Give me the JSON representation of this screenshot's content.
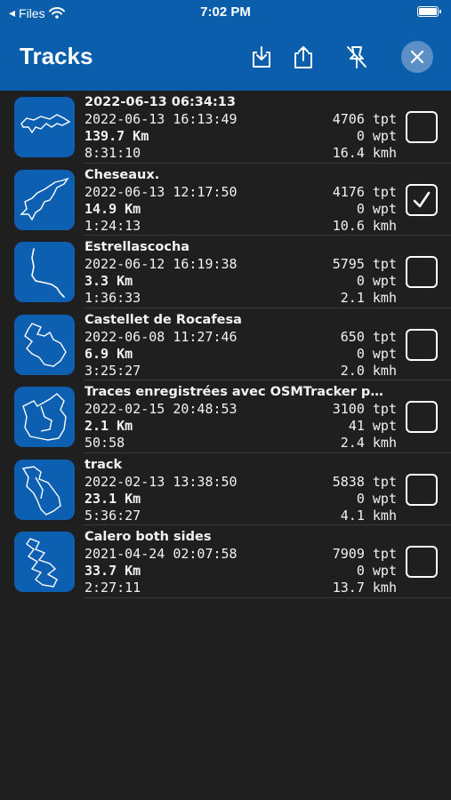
{
  "status": {
    "back_label": "Files",
    "time": "7:02 PM"
  },
  "header": {
    "title": "Tracks",
    "download_icon": "download-icon",
    "share_icon": "share-icon",
    "unpin_icon": "pin-slash-icon",
    "close_icon": "close-icon"
  },
  "tracks": [
    {
      "name": "2022-06-13 06:34:13",
      "date": "2022-06-13 16:13:49",
      "distance": "139.7 Km",
      "duration": "8:31:10",
      "tpt": "4706 tpt",
      "wpt": "0 wpt",
      "speed": "16.4 kmh",
      "checked": false
    },
    {
      "name": "Cheseaux.",
      "date": "2022-06-13 12:17:50",
      "distance": "14.9 Km",
      "duration": "1:24:13",
      "tpt": "4176 tpt",
      "wpt": "0 wpt",
      "speed": "10.6 kmh",
      "checked": true
    },
    {
      "name": "Estrellascocha",
      "date": "2022-06-12 16:19:38",
      "distance": "3.3 Km",
      "duration": "1:36:33",
      "tpt": "5795 tpt",
      "wpt": "0 wpt",
      "speed": "2.1 kmh",
      "checked": false
    },
    {
      "name": "Castellet de Rocafesa",
      "date": "2022-06-08 11:27:46",
      "distance": "6.9 Km",
      "duration": "3:25:27",
      "tpt": "650 tpt",
      "wpt": "0 wpt",
      "speed": "2.0 kmh",
      "checked": false
    },
    {
      "name": "Traces enregistrées avec OSMTracker pou...",
      "date": "2022-02-15 20:48:53",
      "distance": "2.1 Km",
      "duration": "50:58",
      "tpt": "3100 tpt",
      "wpt": "41 wpt",
      "speed": "2.4 kmh",
      "checked": false
    },
    {
      "name": "track",
      "date": "2022-02-13 13:38:50",
      "distance": "23.1 Km",
      "duration": "5:36:27",
      "tpt": "5838 tpt",
      "wpt": "0 wpt",
      "speed": "4.1 kmh",
      "checked": false
    },
    {
      "name": "Calero both sides",
      "date": "2021-04-24 02:07:58",
      "distance": "33.7 Km",
      "duration": "2:27:11",
      "tpt": "7909 tpt",
      "wpt": "0 wpt",
      "speed": "13.7 kmh",
      "checked": false
    }
  ]
}
